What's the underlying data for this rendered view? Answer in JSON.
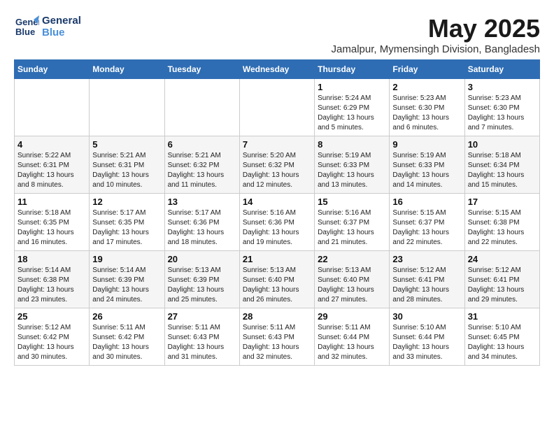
{
  "logo": {
    "line1": "General",
    "line2": "Blue"
  },
  "title": "May 2025",
  "subtitle": "Jamalpur, Mymensingh Division, Bangladesh",
  "days_of_week": [
    "Sunday",
    "Monday",
    "Tuesday",
    "Wednesday",
    "Thursday",
    "Friday",
    "Saturday"
  ],
  "weeks": [
    [
      {
        "day": "",
        "info": ""
      },
      {
        "day": "",
        "info": ""
      },
      {
        "day": "",
        "info": ""
      },
      {
        "day": "",
        "info": ""
      },
      {
        "day": "1",
        "info": "Sunrise: 5:24 AM\nSunset: 6:29 PM\nDaylight: 13 hours and 5 minutes."
      },
      {
        "day": "2",
        "info": "Sunrise: 5:23 AM\nSunset: 6:30 PM\nDaylight: 13 hours and 6 minutes."
      },
      {
        "day": "3",
        "info": "Sunrise: 5:23 AM\nSunset: 6:30 PM\nDaylight: 13 hours and 7 minutes."
      }
    ],
    [
      {
        "day": "4",
        "info": "Sunrise: 5:22 AM\nSunset: 6:31 PM\nDaylight: 13 hours and 8 minutes."
      },
      {
        "day": "5",
        "info": "Sunrise: 5:21 AM\nSunset: 6:31 PM\nDaylight: 13 hours and 10 minutes."
      },
      {
        "day": "6",
        "info": "Sunrise: 5:21 AM\nSunset: 6:32 PM\nDaylight: 13 hours and 11 minutes."
      },
      {
        "day": "7",
        "info": "Sunrise: 5:20 AM\nSunset: 6:32 PM\nDaylight: 13 hours and 12 minutes."
      },
      {
        "day": "8",
        "info": "Sunrise: 5:19 AM\nSunset: 6:33 PM\nDaylight: 13 hours and 13 minutes."
      },
      {
        "day": "9",
        "info": "Sunrise: 5:19 AM\nSunset: 6:33 PM\nDaylight: 13 hours and 14 minutes."
      },
      {
        "day": "10",
        "info": "Sunrise: 5:18 AM\nSunset: 6:34 PM\nDaylight: 13 hours and 15 minutes."
      }
    ],
    [
      {
        "day": "11",
        "info": "Sunrise: 5:18 AM\nSunset: 6:35 PM\nDaylight: 13 hours and 16 minutes."
      },
      {
        "day": "12",
        "info": "Sunrise: 5:17 AM\nSunset: 6:35 PM\nDaylight: 13 hours and 17 minutes."
      },
      {
        "day": "13",
        "info": "Sunrise: 5:17 AM\nSunset: 6:36 PM\nDaylight: 13 hours and 18 minutes."
      },
      {
        "day": "14",
        "info": "Sunrise: 5:16 AM\nSunset: 6:36 PM\nDaylight: 13 hours and 19 minutes."
      },
      {
        "day": "15",
        "info": "Sunrise: 5:16 AM\nSunset: 6:37 PM\nDaylight: 13 hours and 21 minutes."
      },
      {
        "day": "16",
        "info": "Sunrise: 5:15 AM\nSunset: 6:37 PM\nDaylight: 13 hours and 22 minutes."
      },
      {
        "day": "17",
        "info": "Sunrise: 5:15 AM\nSunset: 6:38 PM\nDaylight: 13 hours and 22 minutes."
      }
    ],
    [
      {
        "day": "18",
        "info": "Sunrise: 5:14 AM\nSunset: 6:38 PM\nDaylight: 13 hours and 23 minutes."
      },
      {
        "day": "19",
        "info": "Sunrise: 5:14 AM\nSunset: 6:39 PM\nDaylight: 13 hours and 24 minutes."
      },
      {
        "day": "20",
        "info": "Sunrise: 5:13 AM\nSunset: 6:39 PM\nDaylight: 13 hours and 25 minutes."
      },
      {
        "day": "21",
        "info": "Sunrise: 5:13 AM\nSunset: 6:40 PM\nDaylight: 13 hours and 26 minutes."
      },
      {
        "day": "22",
        "info": "Sunrise: 5:13 AM\nSunset: 6:40 PM\nDaylight: 13 hours and 27 minutes."
      },
      {
        "day": "23",
        "info": "Sunrise: 5:12 AM\nSunset: 6:41 PM\nDaylight: 13 hours and 28 minutes."
      },
      {
        "day": "24",
        "info": "Sunrise: 5:12 AM\nSunset: 6:41 PM\nDaylight: 13 hours and 29 minutes."
      }
    ],
    [
      {
        "day": "25",
        "info": "Sunrise: 5:12 AM\nSunset: 6:42 PM\nDaylight: 13 hours and 30 minutes."
      },
      {
        "day": "26",
        "info": "Sunrise: 5:11 AM\nSunset: 6:42 PM\nDaylight: 13 hours and 30 minutes."
      },
      {
        "day": "27",
        "info": "Sunrise: 5:11 AM\nSunset: 6:43 PM\nDaylight: 13 hours and 31 minutes."
      },
      {
        "day": "28",
        "info": "Sunrise: 5:11 AM\nSunset: 6:43 PM\nDaylight: 13 hours and 32 minutes."
      },
      {
        "day": "29",
        "info": "Sunrise: 5:11 AM\nSunset: 6:44 PM\nDaylight: 13 hours and 32 minutes."
      },
      {
        "day": "30",
        "info": "Sunrise: 5:10 AM\nSunset: 6:44 PM\nDaylight: 13 hours and 33 minutes."
      },
      {
        "day": "31",
        "info": "Sunrise: 5:10 AM\nSunset: 6:45 PM\nDaylight: 13 hours and 34 minutes."
      }
    ]
  ]
}
